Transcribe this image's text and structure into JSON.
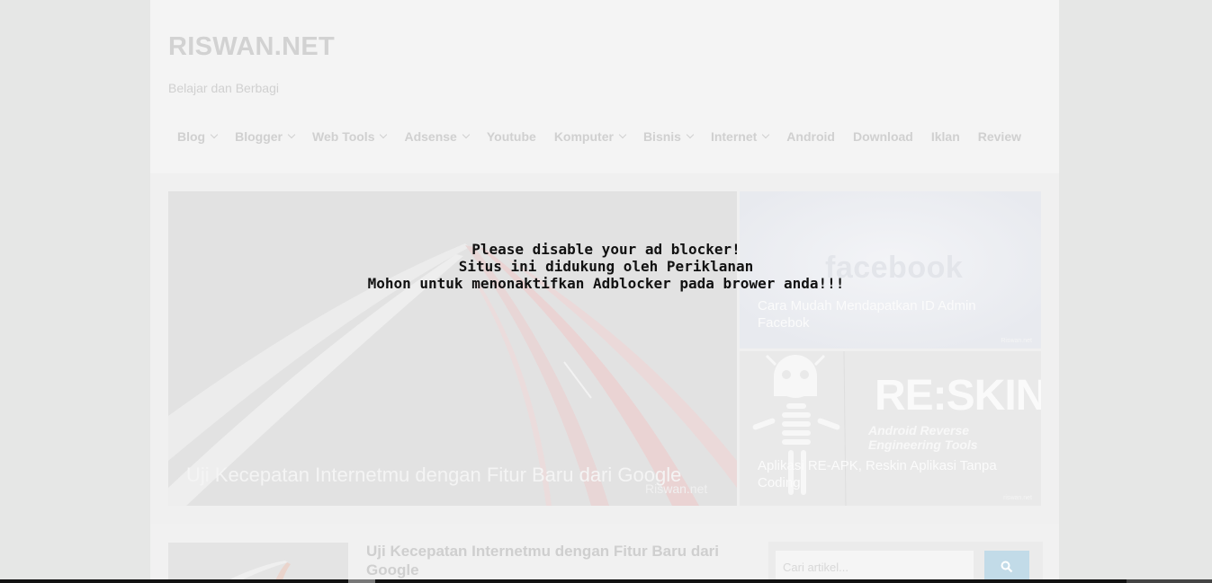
{
  "site": {
    "title": "RISWAN.NET",
    "tagline": "Belajar dan Berbagi"
  },
  "nav": {
    "items": [
      {
        "label": "Blog",
        "dropdown": true
      },
      {
        "label": "Blogger",
        "dropdown": true
      },
      {
        "label": "Web Tools",
        "dropdown": true
      },
      {
        "label": "Adsense",
        "dropdown": true
      },
      {
        "label": "Youtube",
        "dropdown": false
      },
      {
        "label": "Komputer",
        "dropdown": true
      },
      {
        "label": "Bisnis",
        "dropdown": true
      },
      {
        "label": "Internet",
        "dropdown": true
      },
      {
        "label": "Android",
        "dropdown": false
      },
      {
        "label": "Download",
        "dropdown": false
      },
      {
        "label": "Iklan",
        "dropdown": false
      },
      {
        "label": "Review",
        "dropdown": false
      }
    ]
  },
  "slider": {
    "main": {
      "caption": "Uji Kecepatan Internetmu dengan Fitur Baru dari Google",
      "watermark": "Riswan.net"
    },
    "side1": {
      "caption": "Cara Mudah Mendapatkan ID Admin Facebok",
      "image_text": "facebook",
      "watermark": "Riswan.net"
    },
    "side2": {
      "caption": "Aplikasi RE-APK, Reskin Aplikasi Tanpa Coding",
      "image_title": "RE:SKIN",
      "image_subtitle": "Android Reverse Engineering Tools",
      "watermark": "riswan.net"
    }
  },
  "adblock_notice": {
    "line1": "Please disable your ad blocker!",
    "line2": "Situs ini didukung oleh Periklanan",
    "line3": "Mohon untuk menonaktifkan Adblocker pada brower anda!!!"
  },
  "post": {
    "title": "Uji Kecepatan Internetmu dengan Fitur Baru dari Google"
  },
  "search": {
    "placeholder": "Cari artikel..."
  },
  "colors": {
    "search_button": "#c2dbe8",
    "overlay_text": "#111111"
  }
}
